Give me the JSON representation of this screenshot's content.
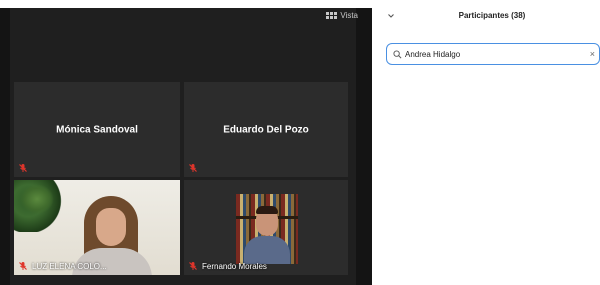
{
  "video": {
    "view_label": "Vista",
    "tiles": [
      {
        "name": "Mónica Sandoval",
        "muted": true
      },
      {
        "name": "Eduardo Del Pozo",
        "muted": true
      },
      {
        "name": "LUZ ELENA COLO...",
        "muted": true
      },
      {
        "name": "Fernando Morales",
        "muted": true
      }
    ]
  },
  "participants_panel": {
    "title": "Participantes (38)",
    "search": {
      "value": "Andrea Hidalgo",
      "clear_icon": "×"
    }
  },
  "colors": {
    "video_background": "#1f1f1f",
    "tile_background": "#2c2c2c",
    "muted_icon": "#e0352b",
    "search_border": "#4a90e2"
  }
}
